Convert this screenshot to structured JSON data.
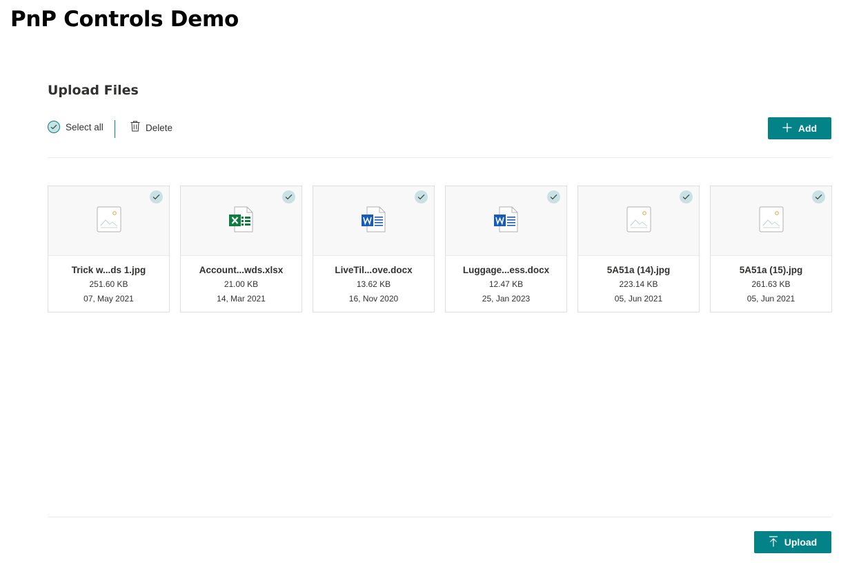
{
  "page": {
    "title": "PnP Controls Demo"
  },
  "section": {
    "title": "Upload Files"
  },
  "toolbar": {
    "select_all_label": "Select all",
    "delete_label": "Delete",
    "add_label": "Add"
  },
  "files": [
    {
      "name": "Trick w...ds 1.jpg",
      "size": "251.60 KB",
      "date": "07, May 2021",
      "icon": "image-icon",
      "selected": true
    },
    {
      "name": "Account...wds.xlsx",
      "size": "21.00 KB",
      "date": "14, Mar 2021",
      "icon": "excel-icon",
      "selected": true
    },
    {
      "name": "LiveTil...ove.docx",
      "size": "13.62 KB",
      "date": "16, Nov 2020",
      "icon": "word-icon",
      "selected": true
    },
    {
      "name": "Luggage...ess.docx",
      "size": "12.47 KB",
      "date": "25, Jan 2023",
      "icon": "word-icon",
      "selected": true
    },
    {
      "name": "5A51a (14).jpg",
      "size": "223.14 KB",
      "date": "05, Jun 2021",
      "icon": "image-icon",
      "selected": true
    },
    {
      "name": "5A51a (15).jpg",
      "size": "261.63 KB",
      "date": "05, Jun 2021",
      "icon": "image-icon",
      "selected": true
    }
  ],
  "footer": {
    "upload_label": "Upload"
  },
  "colors": {
    "accent": "#038387",
    "check_bg": "#c8e1e3",
    "excel": "#107c41",
    "word": "#185abd"
  }
}
